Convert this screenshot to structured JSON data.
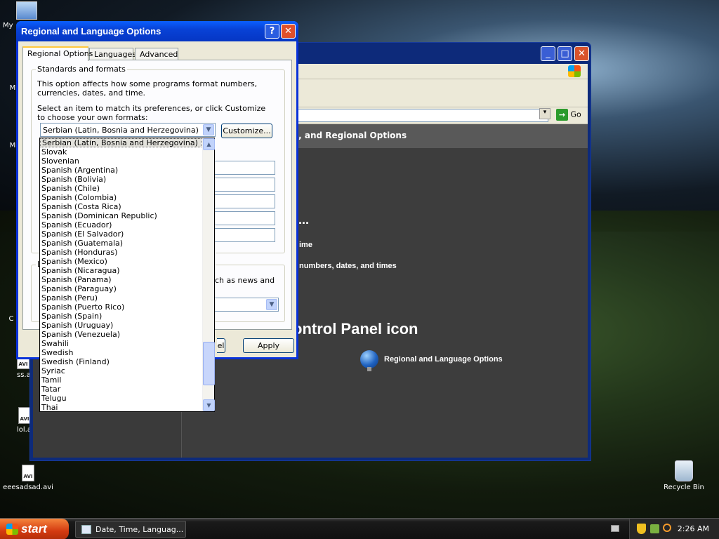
{
  "desktop": {
    "icons": [
      {
        "label": "My",
        "kind": "computer"
      },
      {
        "label": "ss.a",
        "kind": "avi"
      },
      {
        "label": "lol.a",
        "kind": "avi"
      },
      {
        "label": "eeesadsad.avi",
        "kind": "avi"
      },
      {
        "label": "Recycle Bin",
        "kind": "recycle-bin"
      }
    ],
    "partial_labels": [
      "M",
      "M",
      "C"
    ]
  },
  "background_window": {
    "header_text": "e, and Regional Options",
    "pick_task_ellipsis": "...",
    "task_time": "ime",
    "task_numbers": "numbers, dates, and times",
    "pick_icon_heading": "ontrol Panel icon",
    "regional_link": "Regional and Language Options",
    "go_label": "Go"
  },
  "dialog": {
    "title": "Regional and Language Options",
    "help_glyph": "?",
    "close_glyph": "✕",
    "tabs": [
      {
        "label": "Regional Options",
        "active": true
      },
      {
        "label": "Languages",
        "active": false
      },
      {
        "label": "Advanced",
        "active": false
      }
    ],
    "standards_group_label": "Standards and formats",
    "description": "This option affects how some programs format numbers, currencies, dates, and time.",
    "instruction": "Select an item to match its preferences, or click Customize to choose your own formats:",
    "selected_format": "Serbian (Latin, Bosnia and Herzegovina)",
    "customize_label": "Customize...",
    "location_group_label": "L",
    "location_text": "uch as news and",
    "cancel_partial": "el",
    "apply_label": "Apply"
  },
  "dropdown": {
    "items": [
      "Serbian (Latin, Bosnia and Herzegovina)",
      "Slovak",
      "Slovenian",
      "Spanish (Argentina)",
      "Spanish (Bolivia)",
      "Spanish (Chile)",
      "Spanish (Colombia)",
      "Spanish (Costa Rica)",
      "Spanish (Dominican Republic)",
      "Spanish (Ecuador)",
      "Spanish (El Salvador)",
      "Spanish (Guatemala)",
      "Spanish (Honduras)",
      "Spanish (Mexico)",
      "Spanish (Nicaragua)",
      "Spanish (Panama)",
      "Spanish (Paraguay)",
      "Spanish (Peru)",
      "Spanish (Puerto Rico)",
      "Spanish (Spain)",
      "Spanish (Uruguay)",
      "Spanish (Venezuela)",
      "Swahili",
      "Swedish",
      "Swedish (Finland)",
      "Syriac",
      "Tamil",
      "Tatar",
      "Telugu",
      "Thai"
    ],
    "selected_index": 0
  },
  "taskbar": {
    "start_label": "start",
    "task_label": "Date, Time, Languag...",
    "clock": "2:26 AM"
  }
}
